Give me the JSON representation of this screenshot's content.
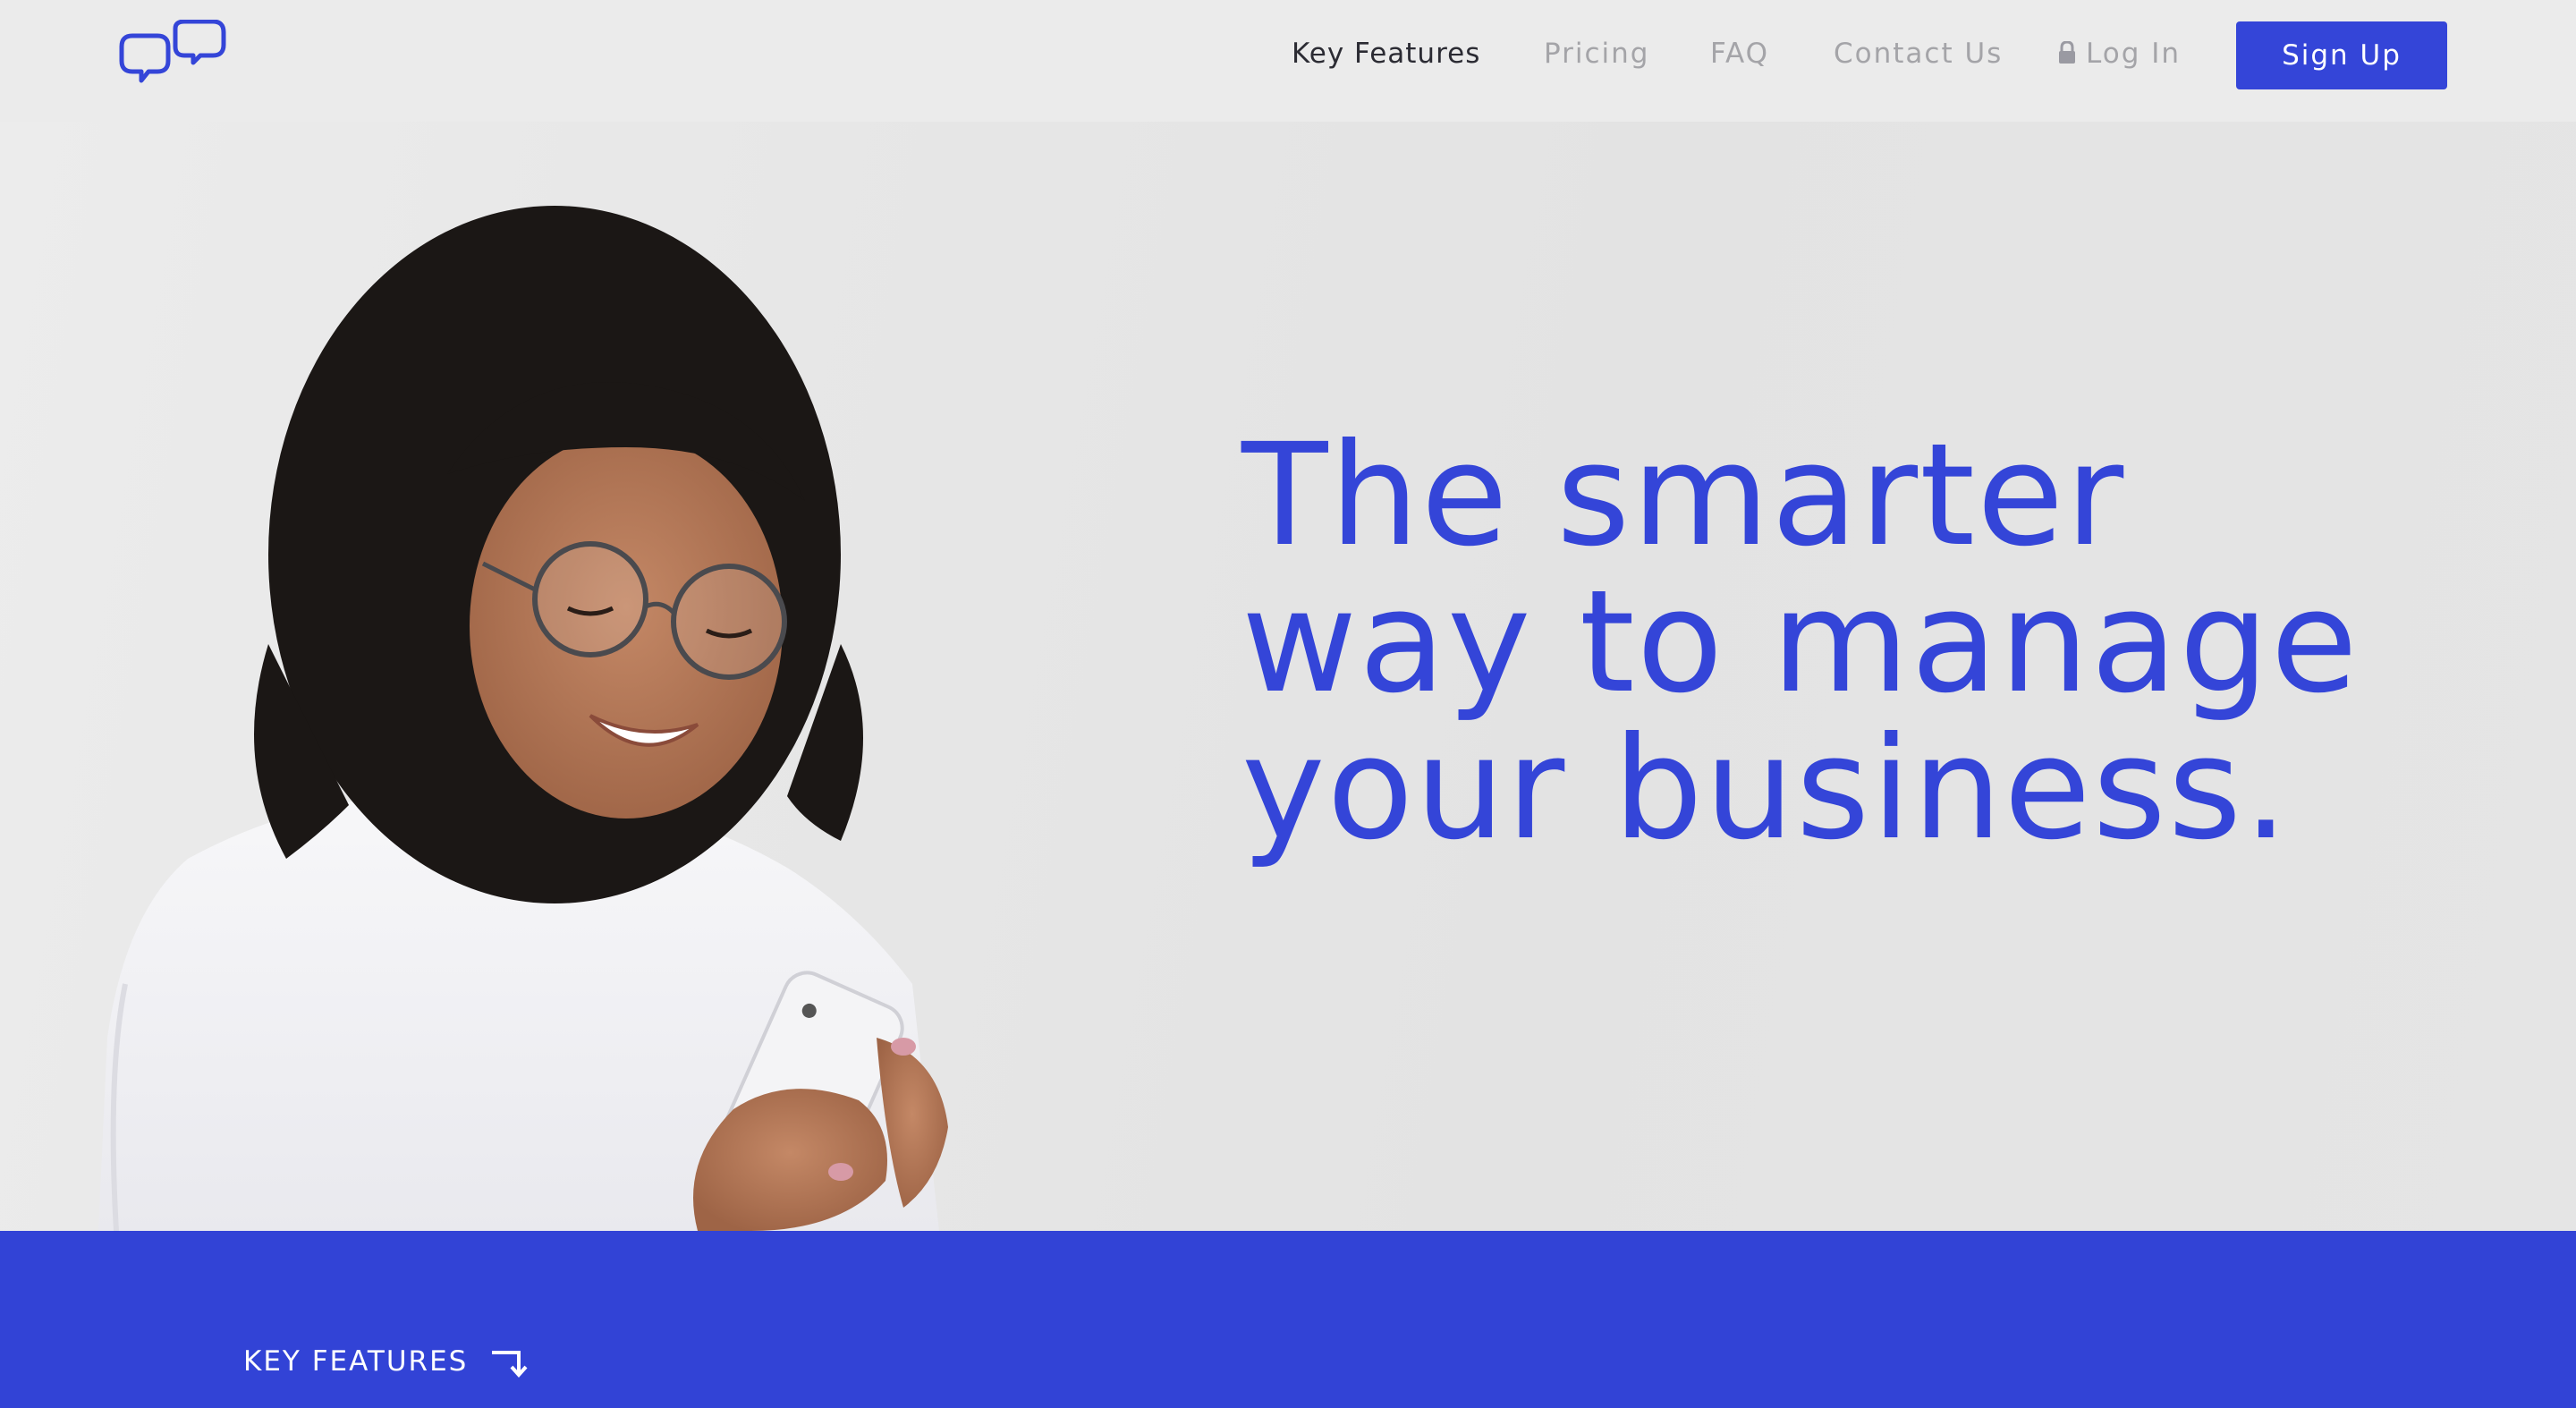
{
  "nav": {
    "items": [
      {
        "label": "Key Features",
        "active": true
      },
      {
        "label": "Pricing",
        "active": false
      },
      {
        "label": "FAQ",
        "active": false
      },
      {
        "label": "Contact Us",
        "active": false
      }
    ],
    "login_label": "Log In",
    "signup_label": "Sign Up"
  },
  "hero": {
    "headline_lines": [
      "The smarter",
      "way to manage",
      "your business."
    ]
  },
  "features": {
    "label": "KEY FEATURES"
  },
  "icons": {
    "logo": "chat-bubbles-icon",
    "login": "lock-icon",
    "features_arrow": "arrow-down-right-icon"
  },
  "colors": {
    "brand_blue": "#3445d8",
    "band_blue": "#3243d6",
    "nav_inactive": "#a4a4a8",
    "nav_active": "#2b2b33",
    "background": "#e6e6e6"
  }
}
